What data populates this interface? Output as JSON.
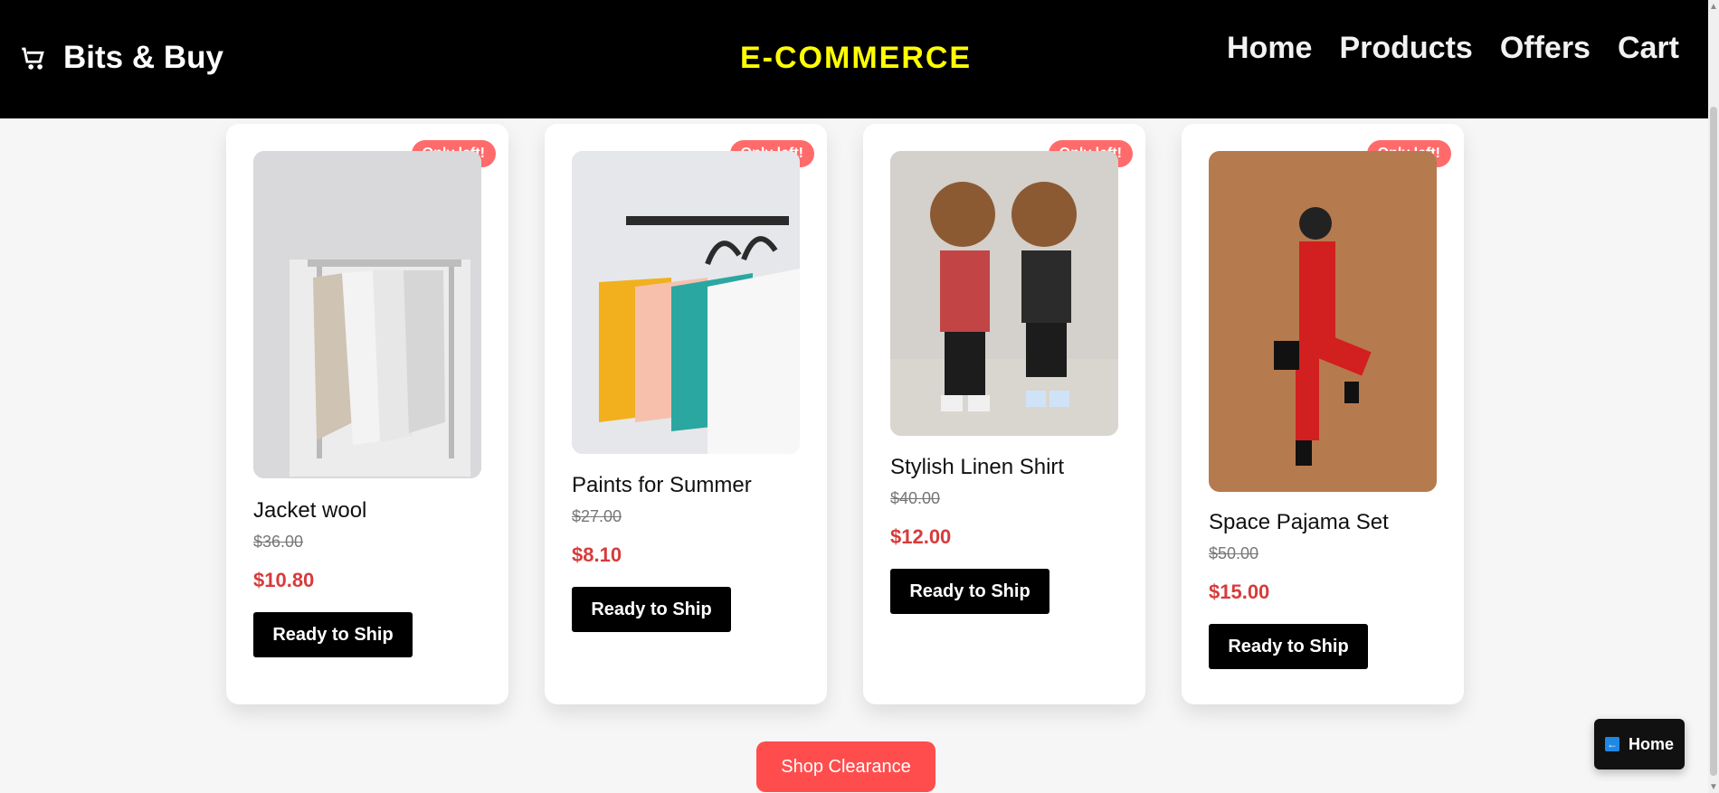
{
  "header": {
    "brand": "Bits & Buy",
    "center_title": "E-COMMERCE",
    "nav": [
      "Home",
      "Products",
      "Offers",
      "Cart"
    ]
  },
  "products": [
    {
      "title": "Jacket wool",
      "old_price": "$36.00",
      "new_price": "$10.80",
      "badge": "Only left!",
      "button": "Ready to Ship"
    },
    {
      "title": "Paints for Summer",
      "old_price": "$27.00",
      "new_price": "$8.10",
      "badge": "Only left!",
      "button": "Ready to Ship"
    },
    {
      "title": "Stylish Linen Shirt",
      "old_price": "$40.00",
      "new_price": "$12.00",
      "badge": "Only left!",
      "button": "Ready to Ship"
    },
    {
      "title": "Space Pajama Set",
      "old_price": "$50.00",
      "new_price": "$15.00",
      "badge": "Only left!",
      "button": "Ready to Ship"
    }
  ],
  "actions": {
    "clearance": "Shop Clearance",
    "home_float": "Home"
  },
  "colors": {
    "header_bg": "#000000",
    "accent_title": "#ffff00",
    "price_red": "#d73b3b",
    "badge_bg": "#ff6b6b",
    "button_black": "#000000",
    "clearance_red": "#ff4d4d"
  },
  "icons": {
    "brand_icon": "cart-icon",
    "home_float_icon": "arrow-left-icon"
  }
}
